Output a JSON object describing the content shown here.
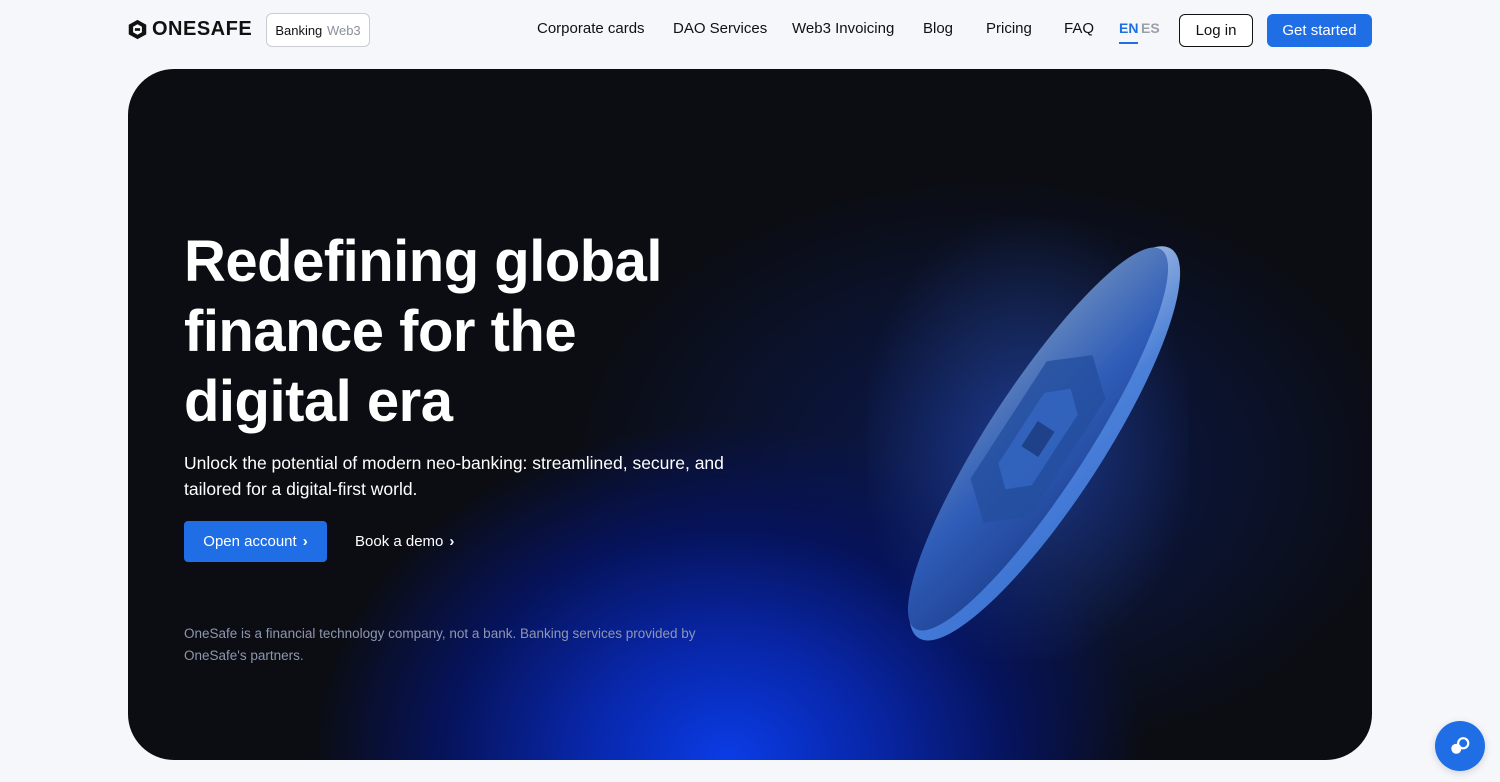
{
  "header": {
    "logo_text": "ONESAFE",
    "mode_switch": {
      "active": "Banking",
      "inactive": "Web3"
    },
    "nav": [
      "Corporate cards",
      "DAO Services",
      "Web3 Invoicing",
      "Blog",
      "Pricing",
      "FAQ"
    ],
    "lang": {
      "active": "EN",
      "inactive": "ES"
    },
    "login_label": "Log in",
    "cta_label": "Get started"
  },
  "hero": {
    "title": "Redefining global finance for the digital era",
    "subtitle": "Unlock the potential of modern neo-banking: streamlined, secure, and tailored for a digital-first world.",
    "primary_button": "Open account",
    "secondary_button": "Book a demo",
    "disclaimer": "OneSafe is a financial technology company, not a bank. Banking services provided by OneSafe's partners."
  },
  "icons": {
    "logo": "onesafe-logo-icon",
    "chevron": "chevron-right-icon",
    "chat": "chat-bubble-icon"
  },
  "colors": {
    "accent": "#1f6ee6",
    "hero_bg": "#0b0d12",
    "hero_glow": "#0a3ce6",
    "page_bg": "#f5f7fb"
  }
}
